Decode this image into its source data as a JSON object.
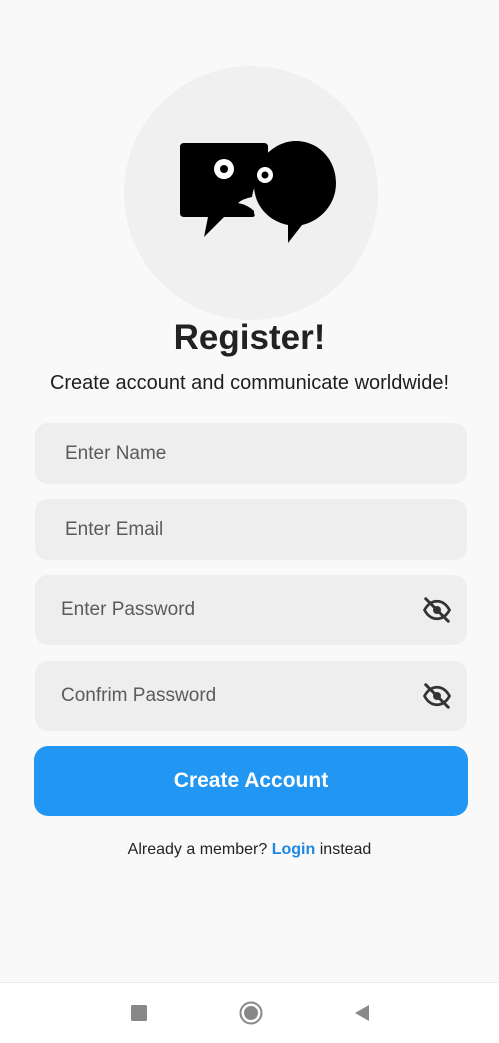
{
  "header": {
    "title": "Register!",
    "subtitle": "Create account and communicate worldwide!"
  },
  "form": {
    "name": {
      "placeholder": "Enter Name",
      "value": ""
    },
    "email": {
      "placeholder": "Enter Email",
      "value": ""
    },
    "password": {
      "placeholder": "Enter Password",
      "value": ""
    },
    "confirm": {
      "placeholder": "Confrim Password",
      "value": ""
    },
    "submit_label": "Create Account"
  },
  "footer": {
    "prefix": "Already a member?",
    "link": "Login",
    "suffix": "instead"
  },
  "colors": {
    "accent": "#2196f3",
    "link": "#1e88e5"
  },
  "icons": {
    "logo": "chat-bubbles-logo-icon",
    "password_toggle": "eye-off-icon",
    "nav_recents": "square-icon",
    "nav_home": "circle-icon",
    "nav_back": "triangle-back-icon"
  }
}
